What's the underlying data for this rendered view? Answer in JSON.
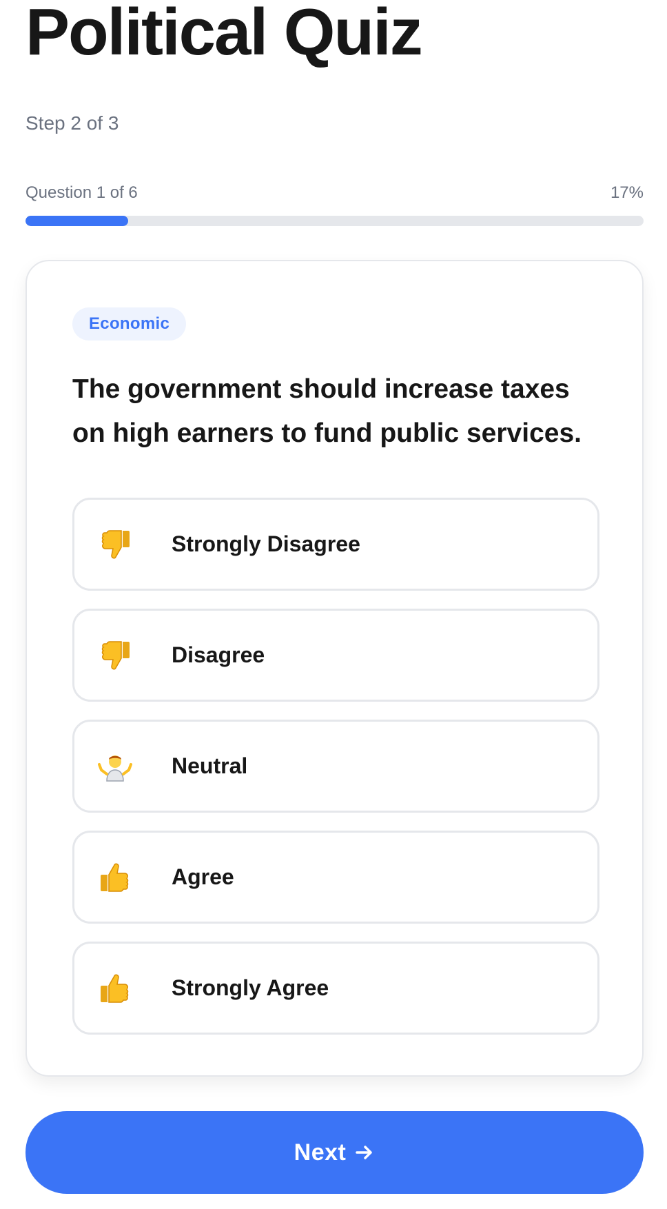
{
  "header": {
    "title": "Political Quiz",
    "step": "Step 2 of 3"
  },
  "progress": {
    "question_label": "Question 1 of 6",
    "percent_label": "17%",
    "fraction": 0.166,
    "color": "#3b74f6"
  },
  "question": {
    "category": "Economic",
    "text": "The government should increase taxes on high earners to fund public services."
  },
  "options": [
    {
      "label": "Strongly Disagree",
      "icon": "thumbs-down-icon"
    },
    {
      "label": "Disagree",
      "icon": "thumbs-down-icon"
    },
    {
      "label": "Neutral",
      "icon": "shrug-icon"
    },
    {
      "label": "Agree",
      "icon": "thumbs-up-icon"
    },
    {
      "label": "Strongly Agree",
      "icon": "thumbs-up-icon"
    }
  ],
  "footer": {
    "next_label": "Next",
    "next_icon": "arrow-right-icon",
    "accent": "#3b74f6"
  }
}
